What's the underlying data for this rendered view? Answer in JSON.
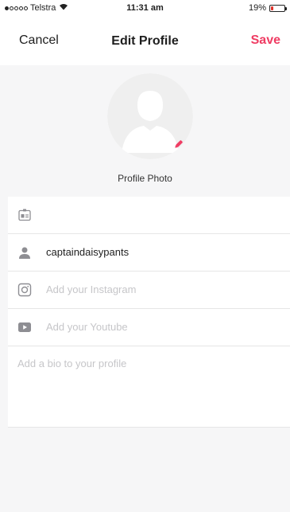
{
  "status_bar": {
    "carrier": "Telstra",
    "time": "11:31 am",
    "battery_label": "19%",
    "battery_level": 0.19
  },
  "nav": {
    "cancel_label": "Cancel",
    "title": "Edit Profile",
    "save_label": "Save",
    "save_color": "#ef3c63"
  },
  "profile_photo": {
    "label": "Profile Photo",
    "edit_icon": "pencil-icon"
  },
  "fields": {
    "display_name": {
      "icon": "id-card-icon",
      "value": ""
    },
    "username": {
      "icon": "person-icon",
      "value": "captaindaisypants"
    },
    "instagram": {
      "icon": "instagram-icon",
      "placeholder": "Add your Instagram"
    },
    "youtube": {
      "icon": "youtube-icon",
      "placeholder": "Add your Youtube"
    },
    "bio": {
      "placeholder": "Add a bio to your profile"
    }
  }
}
